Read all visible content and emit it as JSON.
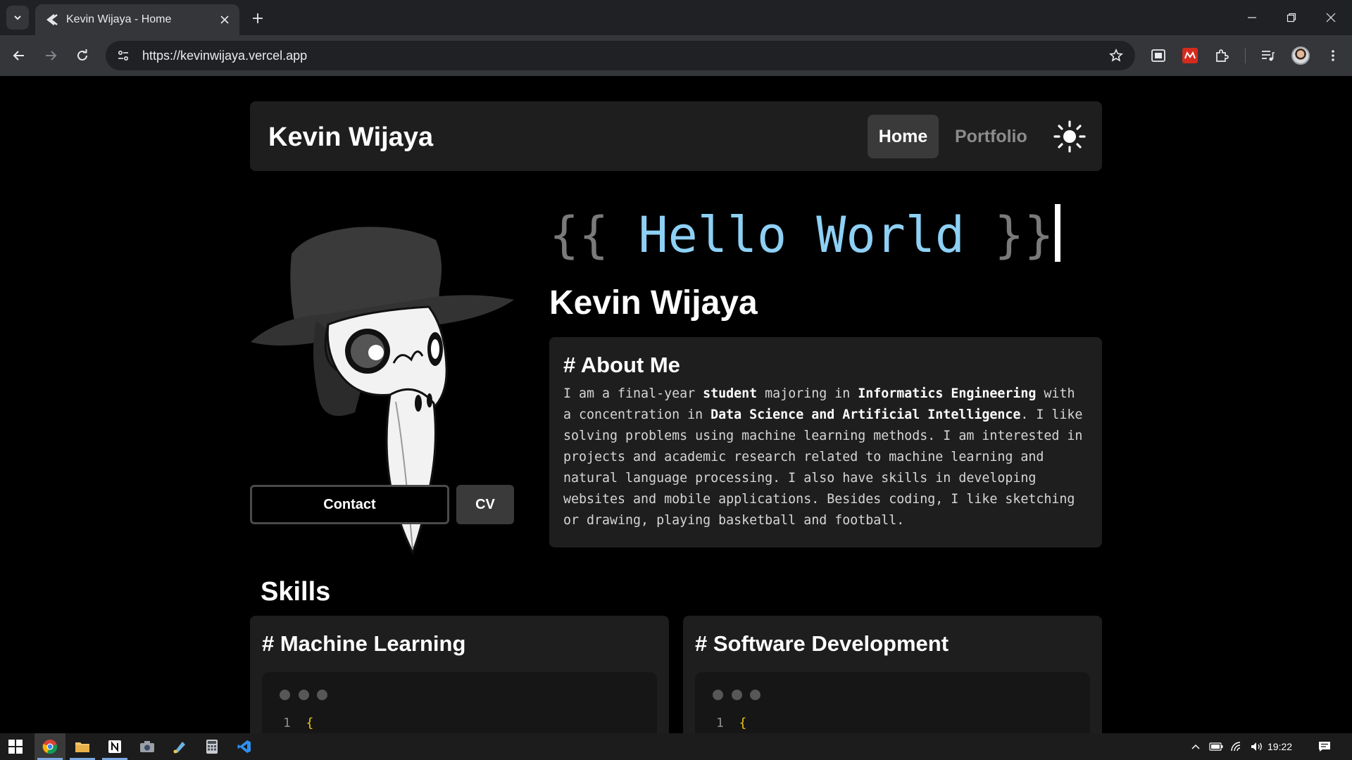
{
  "browser": {
    "tab_title": "Kevin Wijaya - Home",
    "url": "https://kevinwijaya.vercel.app"
  },
  "site": {
    "brand": "Kevin Wijaya",
    "nav": {
      "home": "Home",
      "portfolio": "Portfolio"
    },
    "hero": {
      "hello_open": "{{ ",
      "hello_words": "Hello World",
      "hello_close": " }}",
      "name": "Kevin Wijaya"
    },
    "buttons": {
      "contact": "Contact",
      "cv": "CV"
    },
    "about": {
      "title": "# About Me",
      "segments": [
        {
          "text": "I am a final-year ",
          "bold": false
        },
        {
          "text": "student",
          "bold": true
        },
        {
          "text": " majoring in ",
          "bold": false
        },
        {
          "text": "Informatics Engineering",
          "bold": true
        },
        {
          "text": " with a concentration in ",
          "bold": false
        },
        {
          "text": "Data Science and Artificial Intelligence",
          "bold": true
        },
        {
          "text": ". I like solving problems using machine learning methods. I am interested in projects and academic research related to machine learning and natural language processing. I also have skills in developing websites and mobile applications. Besides coding, I like sketching or drawing, playing basketball and football.",
          "bold": false
        }
      ]
    },
    "skills": {
      "heading": "Skills",
      "cards": [
        {
          "title": "# Machine Learning",
          "line_number": "1",
          "code": "{"
        },
        {
          "title": "# Software Development",
          "line_number": "1",
          "code": "{"
        }
      ]
    }
  },
  "taskbar": {
    "apps": [
      "start-icon",
      "chrome-icon",
      "file-explorer-icon",
      "notion-icon",
      "camera-icon",
      "paint-icon",
      "calculator-icon",
      "vscode-icon"
    ],
    "clock": "19:22"
  },
  "colors": {
    "page_bg": "#000000",
    "card_bg": "#1e1e1e",
    "hello_accent": "#8ed0f5",
    "brace_gray": "#7a7a7a",
    "code_brace": "#f1c40f"
  }
}
